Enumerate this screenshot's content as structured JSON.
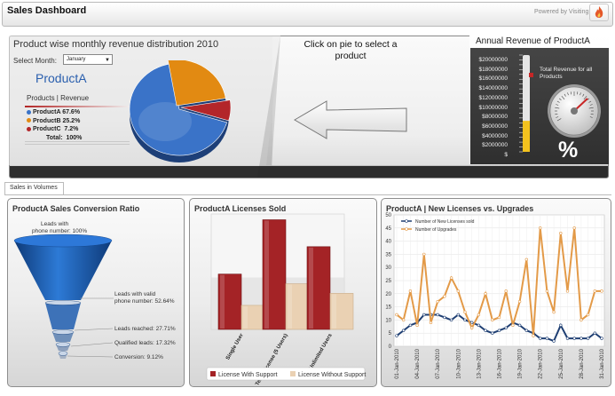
{
  "header": {
    "title": "Sales Dashboard",
    "powered_by": "Powered by Visiting"
  },
  "top": {
    "pie_title": "Product wise monthly revenue distribution 2010",
    "select_label": "Select Month:",
    "select_value": "January",
    "product_title": "ProductA",
    "legend_head": "Products  | Revenue",
    "legend": [
      {
        "name": "ProductA",
        "value": "67.6%",
        "color": "#3a73c8"
      },
      {
        "name": "ProductB",
        "value": "25.2%",
        "color": "#e28a12"
      },
      {
        "name": "ProductC",
        "value": "7.2%",
        "color": "#b3262a"
      }
    ],
    "total_label": "Total:",
    "total_value": "100%",
    "click_text": "Click on pie to select a product",
    "gauge_title": "Annual Revenue of ProductA",
    "gauge_ticks": [
      "$20000000",
      "$18000000",
      "$16000000",
      "$14000000",
      "$12000000",
      "$10000000",
      "$8000000",
      "$6000000",
      "$4000000",
      "$2000000",
      "$"
    ],
    "gauge_label": "Total Revenue for all Products",
    "gauge_symbol": "%"
  },
  "tab": {
    "label": "Sales in Volumes"
  },
  "chart_data": [
    {
      "type": "pie",
      "categories": [
        "ProductA",
        "ProductB",
        "ProductC"
      ],
      "values": [
        67.6,
        25.2,
        7.2
      ],
      "colors": [
        "#3a73c8",
        "#e28a12",
        "#b3262a"
      ]
    },
    {
      "type": "bar",
      "ticks": [
        "$20000000",
        "$18000000",
        "$16000000",
        "$14000000",
        "$12000000",
        "$10000000",
        "$8000000",
        "$6000000",
        "$4000000",
        "$2000000",
        "$"
      ],
      "values": [
        6400000
      ],
      "ylim": [
        0,
        20000000
      ]
    },
    {
      "type": "funnel",
      "title": "ProductA Sales Conversion Ratio",
      "stages": [
        {
          "label": "Leads with phone number: 100%",
          "value": 100
        },
        {
          "label": "Leads with valid phone number: 52.64%",
          "value": 52.64
        },
        {
          "label": "Leads reached: 27.71%",
          "value": 27.71
        },
        {
          "label": "Qualified leads: 17.32%",
          "value": 17.32
        },
        {
          "label": "Conversion: 9.12%",
          "value": 9.12
        }
      ]
    },
    {
      "type": "bar",
      "title": "ProductA Licenses Sold",
      "categories": [
        "Single User",
        "Team License (5 Users)",
        "Unlimited Users"
      ],
      "series": [
        {
          "name": "License With Support",
          "values": [
            115,
            228,
            172
          ],
          "color": "#a42326"
        },
        {
          "name": "License Without Support",
          "values": [
            50,
            95,
            75
          ],
          "color": "#ead1b3"
        }
      ],
      "ylim": [
        0,
        240
      ]
    },
    {
      "type": "line",
      "title": "ProductA | New Licenses vs. Upgrades",
      "x": [
        "01-Jan-2010",
        "02-Jan-2010",
        "03-Jan-2010",
        "04-Jan-2010",
        "05-Jan-2010",
        "06-Jan-2010",
        "07-Jan-2010",
        "08-Jan-2010",
        "09-Jan-2010",
        "10-Jan-2010",
        "11-Jan-2010",
        "12-Jan-2010",
        "13-Jan-2010",
        "14-Jan-2010",
        "15-Jan-2010",
        "16-Jan-2010",
        "17-Jan-2010",
        "18-Jan-2010",
        "19-Jan-2010",
        "20-Jan-2010",
        "21-Jan-2010",
        "22-Jan-2010",
        "23-Jan-2010",
        "24-Jan-2010",
        "25-Jan-2010",
        "26-Jan-2010",
        "27-Jan-2010",
        "28-Jan-2010",
        "29-Jan-2010",
        "30-Jan-2010",
        "31-Jan-2010"
      ],
      "x_tick_labels": [
        "01-Jan-2010",
        "04-Jan-2010",
        "07-Jan-2010",
        "10-Jan-2010",
        "13-Jan-2010",
        "16-Jan-2010",
        "19-Jan-2010",
        "22-Jan-2010",
        "25-Jan-2010",
        "28-Jan-2010",
        "31-Jan-2010"
      ],
      "series": [
        {
          "name": "Number of New Licenses sold",
          "color": "#1f3f73",
          "values": [
            4,
            6,
            8,
            9,
            12,
            12,
            12,
            11,
            10,
            12,
            10,
            9,
            8,
            6,
            5,
            6,
            7,
            9,
            8,
            6,
            5,
            3,
            3,
            2,
            8,
            3,
            3,
            3,
            3,
            5,
            3
          ]
        },
        {
          "name": "Number of Upgrades",
          "color": "#e39a48",
          "values": [
            12,
            10,
            21,
            8,
            35,
            9,
            17,
            19,
            26,
            21,
            13,
            7,
            12,
            20,
            10,
            11,
            21,
            8,
            17,
            33,
            4,
            45,
            21,
            13,
            43,
            21,
            45,
            10,
            12,
            21,
            21
          ]
        }
      ],
      "yticks": [
        0,
        5,
        10,
        15,
        20,
        25,
        30,
        35,
        40,
        45,
        50
      ],
      "ylim": [
        0,
        50
      ]
    }
  ]
}
